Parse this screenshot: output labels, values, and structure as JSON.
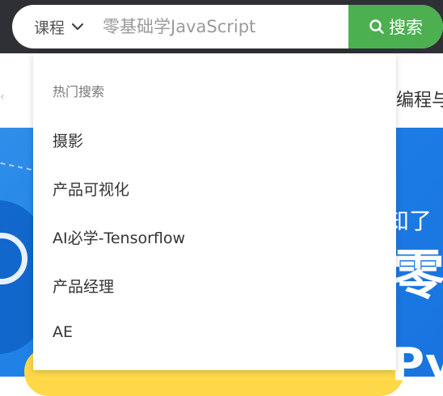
{
  "search": {
    "category": "课程",
    "query_placeholder": "零基础学JavaScript",
    "button_label": "搜索"
  },
  "nav": {
    "partial_label": "编程与"
  },
  "dropdown": {
    "title": "热门搜索",
    "items": [
      "摄影",
      "产品可视化",
      "AI必学-Tensorflow",
      "产品经理",
      "AE"
    ]
  },
  "banner": {
    "line1": "知了",
    "line2": "零",
    "line3": "Py"
  },
  "colors": {
    "topbar": "#2f3035",
    "accent_green": "#4caf50",
    "banner_blue": "#1c7fe6"
  }
}
